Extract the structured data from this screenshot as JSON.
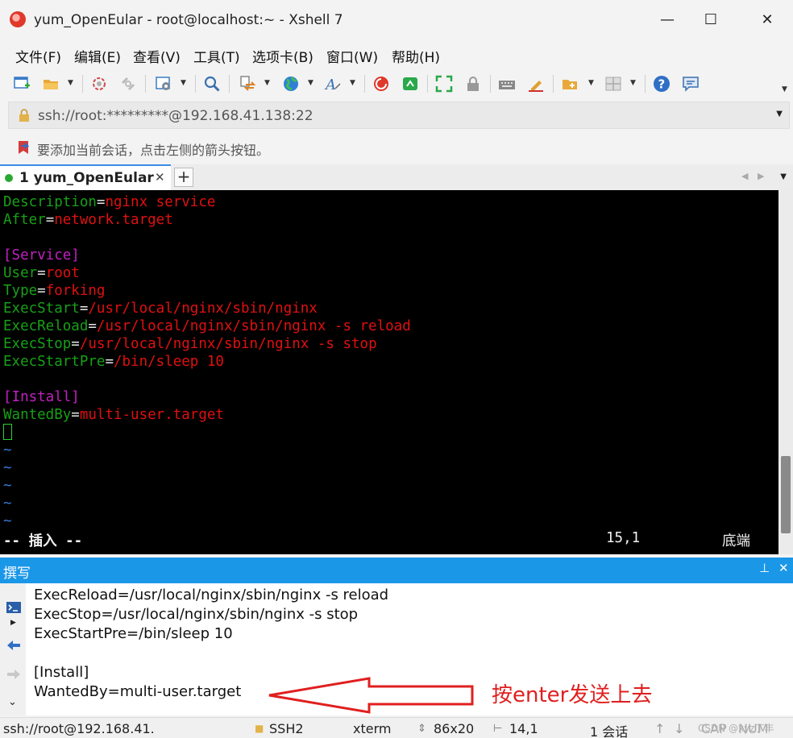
{
  "window": {
    "title": "yum_OpenEular - root@localhost:~ - Xshell 7",
    "minimize": "—",
    "maximize": "☐",
    "close": "✕"
  },
  "menu": [
    "文件(F)",
    "编辑(E)",
    "查看(V)",
    "工具(T)",
    "选项卡(B)",
    "窗口(W)",
    "帮助(H)"
  ],
  "address": {
    "value": "ssh://root:*********@192.168.41.138:22"
  },
  "hint": {
    "text": "要添加当前会话，点击左侧的箭头按钮。"
  },
  "tab": {
    "label": "1 yum_OpenEular",
    "close": "✕",
    "add": "+"
  },
  "terminal": {
    "lines": [
      {
        "key": "Description",
        "sep": "=",
        "val": "nginx service"
      },
      {
        "key": "After",
        "sep": "=",
        "val": "network.target"
      },
      {
        "section": "[Service]"
      },
      {
        "key": "User",
        "sep": "=",
        "val": "root"
      },
      {
        "key": "Type",
        "sep": "=",
        "val": "forking"
      },
      {
        "key": "ExecStart",
        "sep": "=",
        "val": "/usr/local/nginx/sbin/nginx"
      },
      {
        "key": "ExecReload",
        "sep": "=",
        "val": "/usr/local/nginx/sbin/nginx -s reload"
      },
      {
        "key": "ExecStop",
        "sep": "=",
        "val": "/usr/local/nginx/sbin/nginx -s stop"
      },
      {
        "key": "ExecStartPre",
        "sep": "=",
        "val": "/bin/sleep 10"
      },
      {
        "section": "[Install]"
      },
      {
        "key": "WantedBy",
        "sep": "=",
        "val": "multi-user.target"
      }
    ],
    "tilde": "~",
    "mode": "-- 插入 --",
    "position": "15,1",
    "scroll_pos": "底端"
  },
  "compose": {
    "title": "撰写",
    "pin": "📌",
    "close": "✕",
    "lines": [
      "ExecReload=/usr/local/nginx/sbin/nginx -s reload",
      "ExecStop=/usr/local/nginx/sbin/nginx -s stop",
      "ExecStartPre=/bin/sleep 10",
      "",
      "[Install]",
      "WantedBy=multi-user.target"
    ],
    "annotation": "按enter发送上去"
  },
  "statusbar": {
    "connection": "ssh://root@192.168.41.",
    "protocol": "SSH2",
    "terminal_type": "xterm",
    "size": "86x20",
    "cursor": "14,1",
    "sessions": "1 会话",
    "caps": "CAP",
    "num": "NUM"
  },
  "watermark": "CSDN @xyz丁丰",
  "colors": {
    "term_key": "#17a017",
    "term_value": "#e01010",
    "term_section": "#c020c0",
    "compose_header": "#1b97e8",
    "annotation": "#e01f1f"
  }
}
